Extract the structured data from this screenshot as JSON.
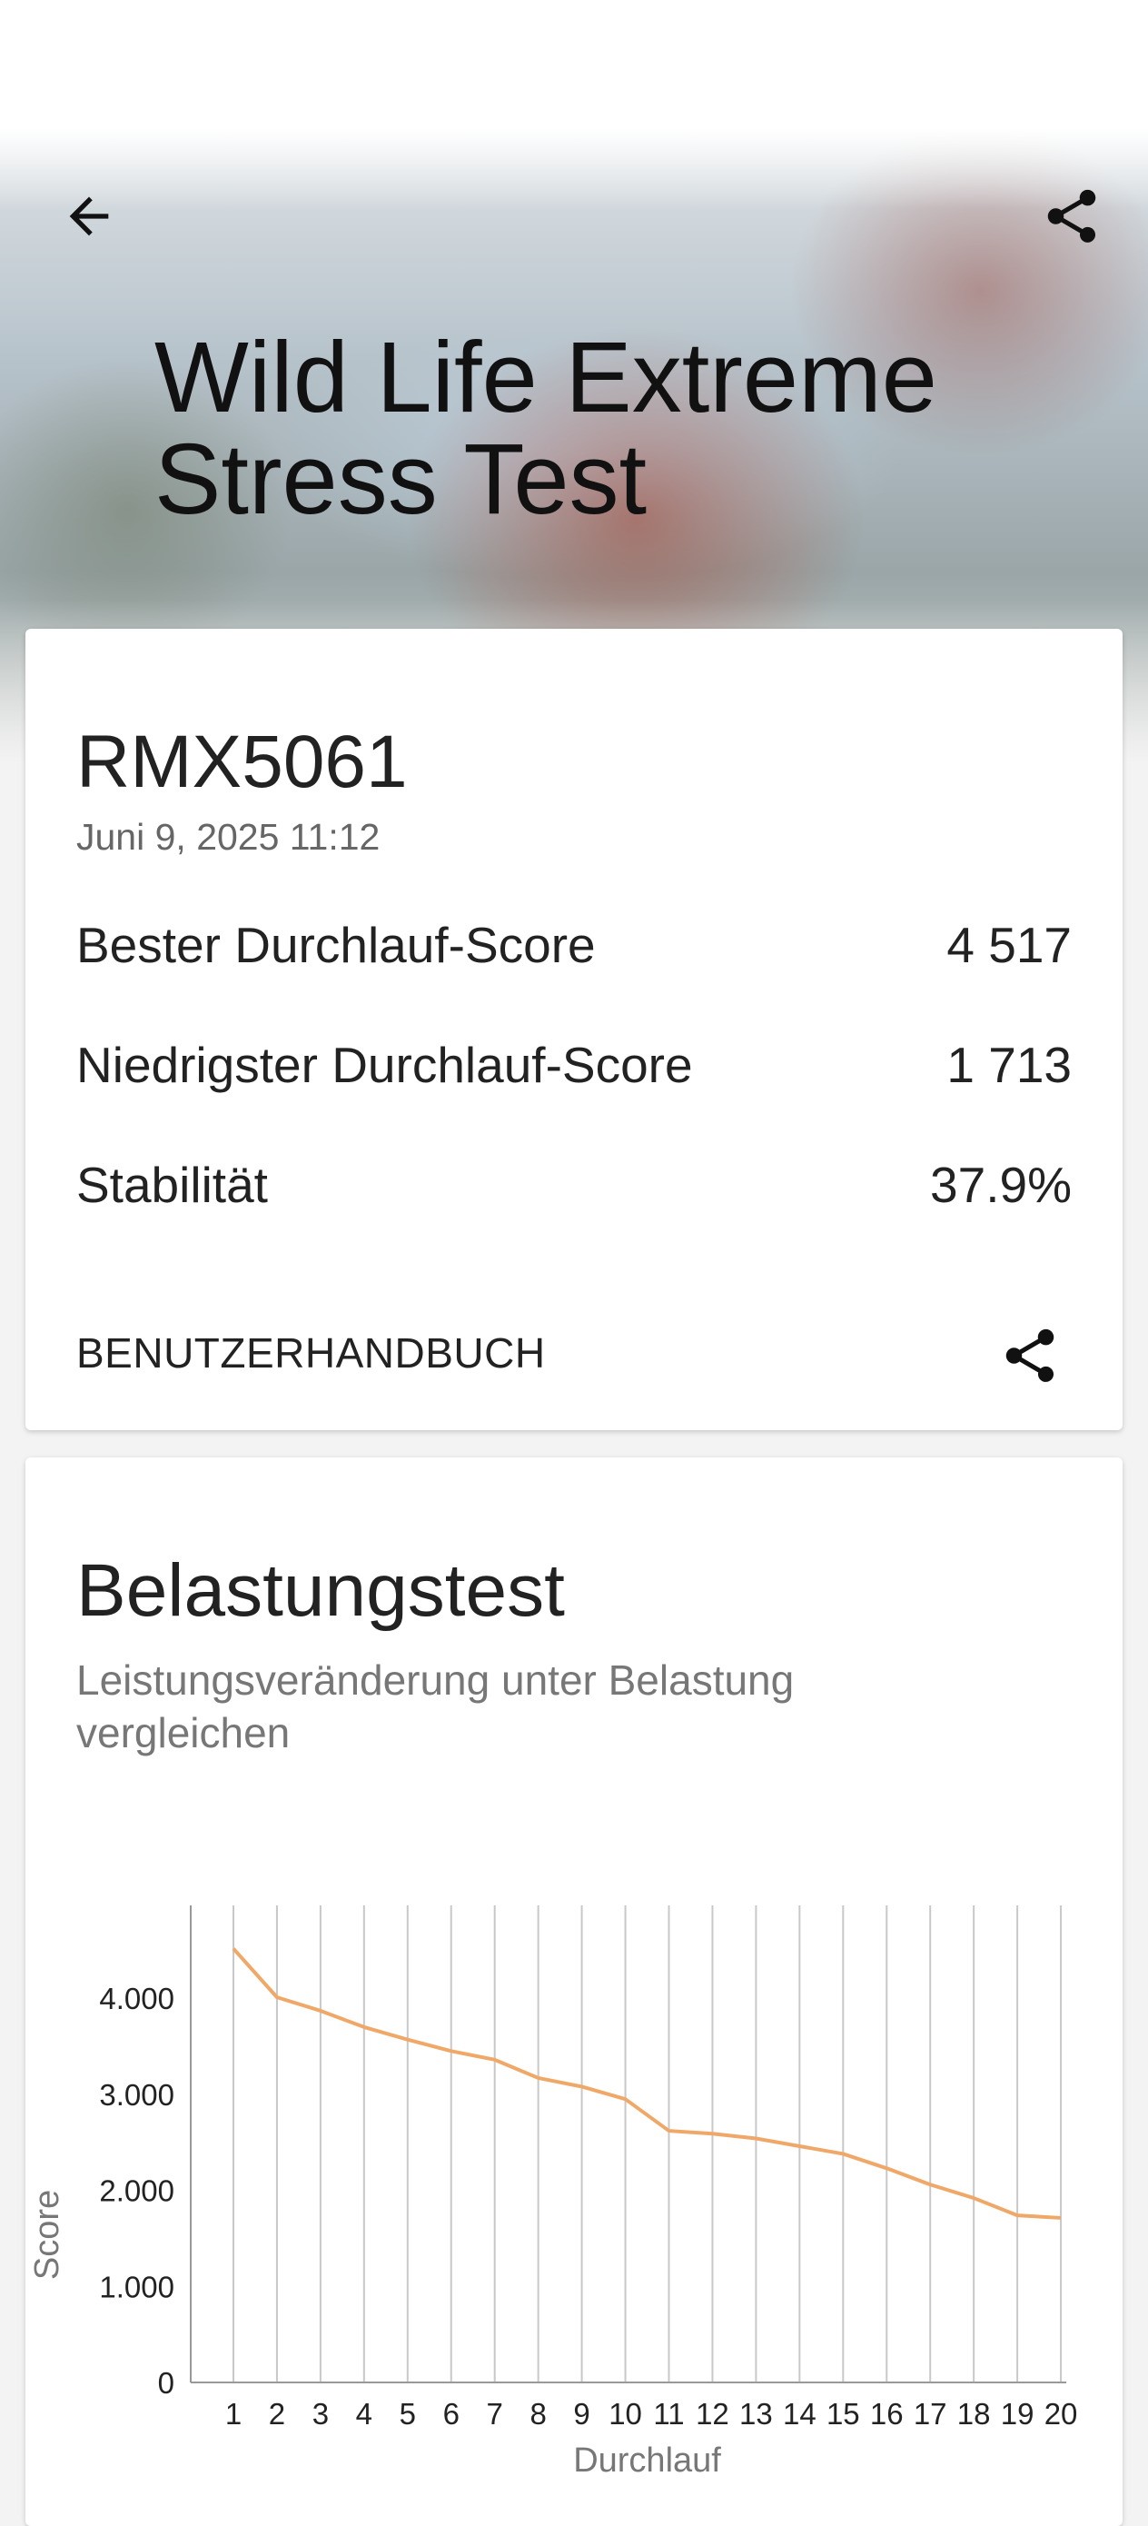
{
  "header": {
    "title_line1": "Wild Life Extreme",
    "title_line2": "Stress Test",
    "back_icon": "arrow-left-icon",
    "share_icon": "share-icon"
  },
  "result": {
    "device": "RMX5061",
    "date": "Juni 9, 2025 11:12",
    "rows": [
      {
        "label": "Bester Durchlauf-Score",
        "value": "4 517"
      },
      {
        "label": "Niedrigster Durchlauf-Score",
        "value": "1 713"
      },
      {
        "label": "Stabilität",
        "value": "37.9%"
      }
    ],
    "manual_label": "BENUTZERHANDBUCH"
  },
  "stress": {
    "title": "Belastungstest",
    "subtitle": "Leistungsveränderung unter Belastung vergleichen"
  },
  "colors": {
    "line": "#f0a868",
    "grid": "#c8c8c8",
    "accent_text": "#212121"
  },
  "chart_data": {
    "type": "line",
    "xlabel": "Durchlauf",
    "ylabel": "Score",
    "x": [
      1,
      2,
      3,
      4,
      5,
      6,
      7,
      8,
      9,
      10,
      11,
      12,
      13,
      14,
      15,
      16,
      17,
      18,
      19,
      20
    ],
    "y_ticks": [
      "0",
      "1.000",
      "2.000",
      "3.000",
      "4.000"
    ],
    "ylim": [
      0,
      5000
    ],
    "grid": "vertical",
    "series": [
      {
        "values": [
          4517,
          4010,
          3870,
          3700,
          3570,
          3450,
          3360,
          3170,
          3080,
          2950,
          2620,
          2590,
          2540,
          2460,
          2380,
          2230,
          2060,
          1920,
          1740,
          1713
        ]
      }
    ]
  }
}
